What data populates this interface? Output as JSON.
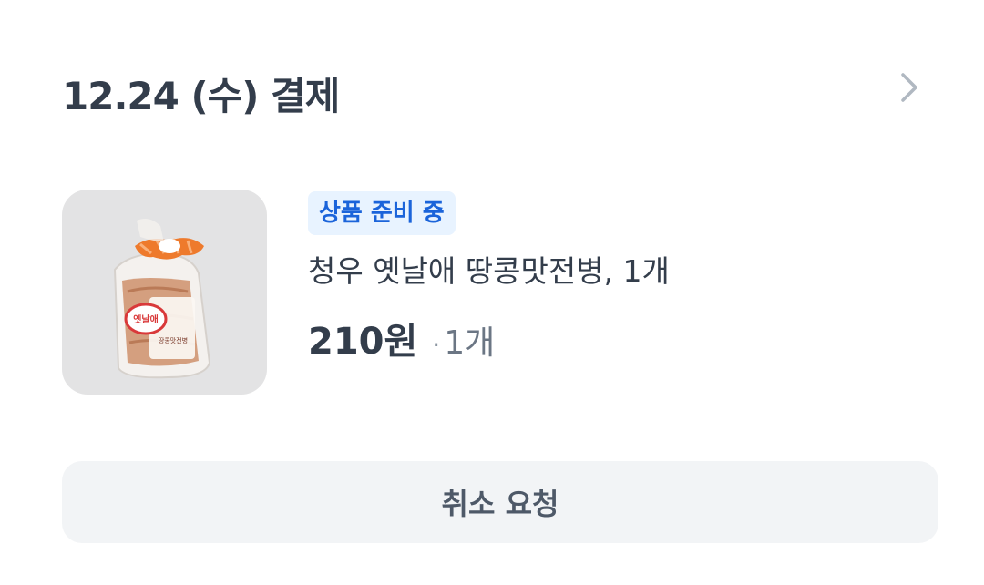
{
  "order": {
    "date_title": "12.24 (수) 결제",
    "chevron_icon": "chevron-right-icon"
  },
  "product": {
    "status": "상품 준비 중",
    "name": "청우 옛날애 땅콩맛전병, 1개",
    "price": "210원",
    "separator": "·",
    "quantity": "1개",
    "package_label_top": "옛날애",
    "package_label_bottom": "땅콩맛전병"
  },
  "actions": {
    "cancel_label": "취소 요청"
  },
  "colors": {
    "badge_bg": "#e8f3ff",
    "badge_text": "#1b64da",
    "button_bg": "#f2f4f6",
    "title_text": "#333d4b"
  }
}
